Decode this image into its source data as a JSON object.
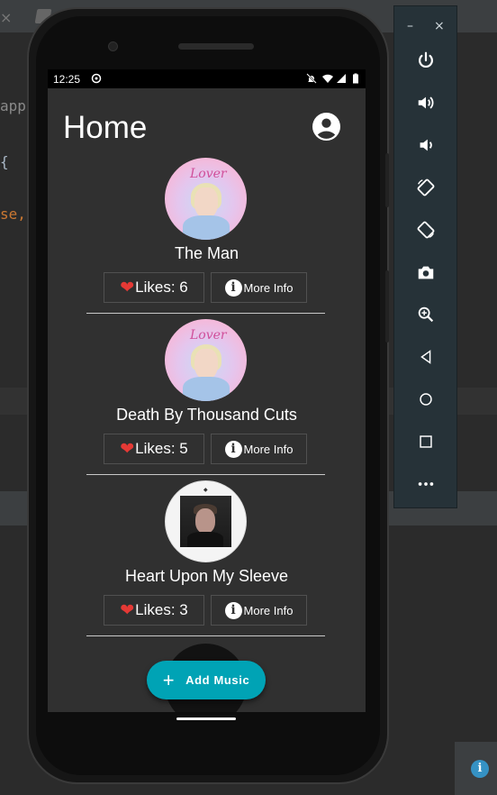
{
  "ide": {
    "close_glyph": "×",
    "code_lines": [
      "app",
      "{",
      "se,"
    ]
  },
  "emulator_toolbar": {
    "minimize_label": "–",
    "close_label": "×",
    "buttons": [
      "power-icon",
      "volume-up-icon",
      "volume-down-icon",
      "rotate-left-icon",
      "rotate-right-icon",
      "camera-icon",
      "zoom-icon",
      "back-icon",
      "home-icon",
      "overview-icon",
      "more-icon"
    ]
  },
  "status_bar": {
    "time": "12:25"
  },
  "app_bar": {
    "title": "Home"
  },
  "songs": [
    {
      "title": "The Man",
      "likes_label": "Likes: 6",
      "more_info_label": "More Info",
      "cover_text": "Lover"
    },
    {
      "title": "Death By Thousand Cuts",
      "likes_label": "Likes: 5",
      "more_info_label": "More Info",
      "cover_text": "Lover"
    },
    {
      "title": "Heart Upon My Sleeve",
      "likes_label": "Likes: 3",
      "more_info_label": "More Info",
      "cover_text": ""
    }
  ],
  "fab": {
    "label": "Add Music"
  },
  "colors": {
    "accent": "#00a3b5",
    "heart": "#e53935",
    "screen_bg": "#303030"
  }
}
